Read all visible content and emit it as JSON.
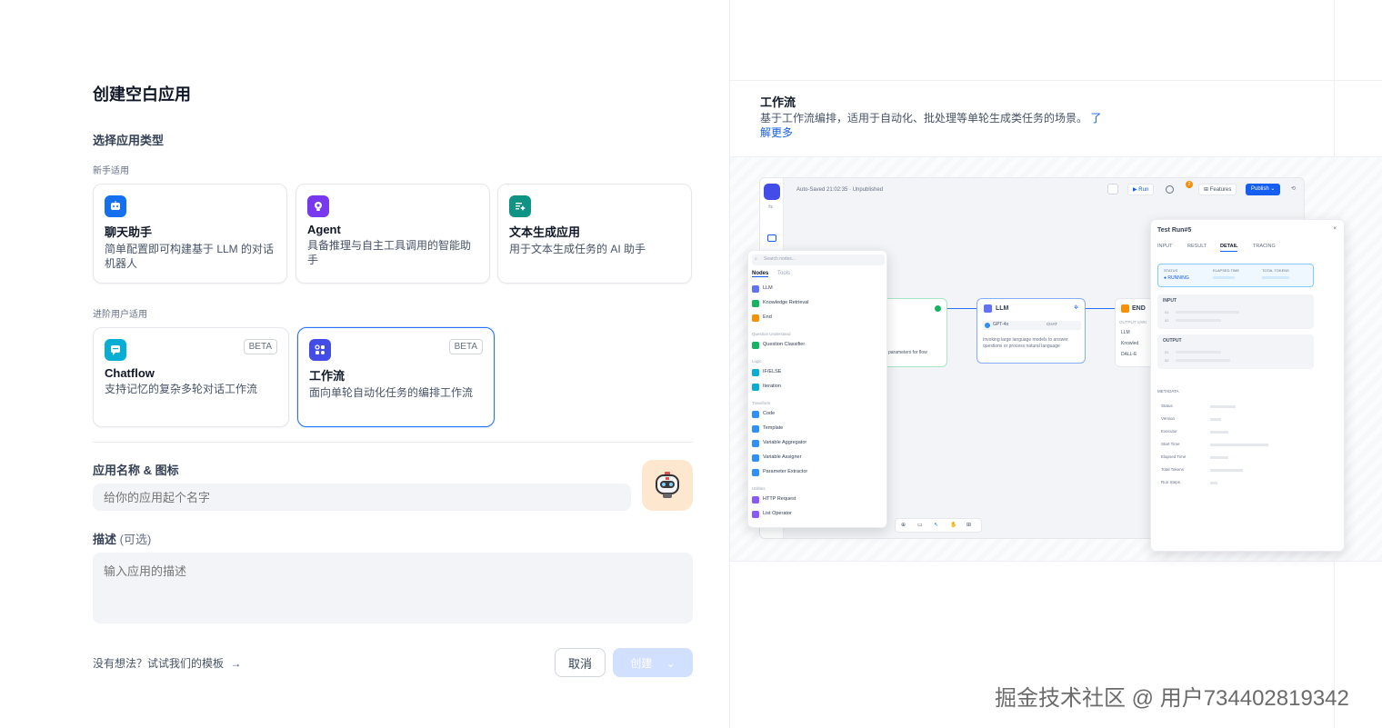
{
  "dialog": {
    "title": "创建空白应用",
    "select_type_label": "选择应用类型",
    "beginner_label": "新手适用",
    "advanced_label": "进阶用户适用",
    "app_types": [
      {
        "name": "聊天助手",
        "desc": "简单配置即可构建基于 LLM 的对话机器人",
        "icon": "chat-bot-icon",
        "color": "#1570ef"
      },
      {
        "name": "Agent",
        "desc": "具备推理与自主工具调用的智能助手",
        "icon": "agent-icon",
        "color": "#7839ee"
      },
      {
        "name": "文本生成应用",
        "desc": "用于文本生成任务的 AI 助手",
        "icon": "text-generate-icon",
        "color": "#0e9384"
      }
    ],
    "advanced_types": [
      {
        "name": "Chatflow",
        "desc": "支持记忆的复杂多轮对话工作流",
        "badge": "BETA",
        "icon": "chatflow-icon",
        "color": "#06aed4"
      },
      {
        "name": "工作流",
        "desc": "面向单轮自动化任务的编排工作流",
        "badge": "BETA",
        "icon": "workflow-icon",
        "color": "#444ce7",
        "selected": true
      }
    ],
    "name_icon_label": "应用名称 & 图标",
    "name_placeholder": "给你的应用起个名字",
    "desc_label": "描述",
    "desc_optional": "(可选)",
    "desc_placeholder": "输入应用的描述",
    "template_link": "没有想法？试试我们的模板",
    "cancel": "取消",
    "create": "创建"
  },
  "preview": {
    "title": "工作流",
    "desc": "基于工作流编排，适用于自动化、批处理等单轮生成类任务的场景。",
    "learn_more": "了解更多",
    "toolbar": {
      "autosaved": "Auto-Saved 21:02:35 · Unpublished",
      "run": "Run",
      "features": "Features",
      "publish": "Publish",
      "notif_count": "2"
    },
    "node_panel": {
      "search": "Search nodes...",
      "tabs": [
        "Nodes",
        "Tools"
      ],
      "items": [
        {
          "label": "LLM",
          "color": "#6172f3"
        },
        {
          "label": "Knowledge Retrieval",
          "color": "#16b364"
        },
        {
          "label": "End",
          "color": "#f79009"
        }
      ],
      "groups": [
        {
          "title": "Question Understand",
          "items": [
            {
              "label": "Question Classifier",
              "color": "#16b364"
            }
          ]
        },
        {
          "title": "Logic",
          "items": [
            {
              "label": "IF/ELSE",
              "color": "#06aed4"
            },
            {
              "label": "Iteration",
              "color": "#06aed4"
            }
          ]
        },
        {
          "title": "Transform",
          "items": [
            {
              "label": "Code",
              "color": "#2e90fa"
            },
            {
              "label": "Template",
              "color": "#2e90fa"
            },
            {
              "label": "Variable Aggregator",
              "color": "#2e90fa"
            },
            {
              "label": "Variable Assigner",
              "color": "#2e90fa"
            },
            {
              "label": "Parameter Extractor",
              "color": "#2e90fa"
            }
          ]
        },
        {
          "title": "Utilities",
          "items": [
            {
              "label": "HTTP Request",
              "color": "#875bf7"
            },
            {
              "label": "List Operator",
              "color": "#875bf7"
            }
          ]
        }
      ]
    },
    "llm_node": {
      "title": "LLM",
      "model": "GPT-4o",
      "mode": "CHAT",
      "desc": "Invoking large language models to answer questions or process natural language"
    },
    "start_node": {
      "desc": "parameters for flow"
    },
    "end_node": {
      "title": "END",
      "output_label": "OUTPUT VARI",
      "vars": [
        "LLM",
        "Knowled",
        "DALL-E"
      ]
    },
    "test_run": {
      "title": "Test Run#5",
      "tabs": [
        "INPUT",
        "RESULT",
        "DETAIL",
        "TRACING"
      ],
      "active_tab": "DETAIL",
      "status_label": "STATUS",
      "status_value": "RUNNING",
      "elapsed_label": "ELAPSED TIME",
      "tokens_label": "TOTAL TOKENS",
      "input_label": "INPUT",
      "output_label": "OUTPUT",
      "row_nums": [
        "01",
        "02"
      ],
      "metadata_label": "METADATA",
      "metadata_keys": [
        "Status",
        "Version",
        "Executor",
        "Start Time",
        "Elapsed Time",
        "Total Tokens",
        "Run Steps"
      ]
    }
  },
  "watermark": "掘金技术社区 @ 用户734402819342"
}
